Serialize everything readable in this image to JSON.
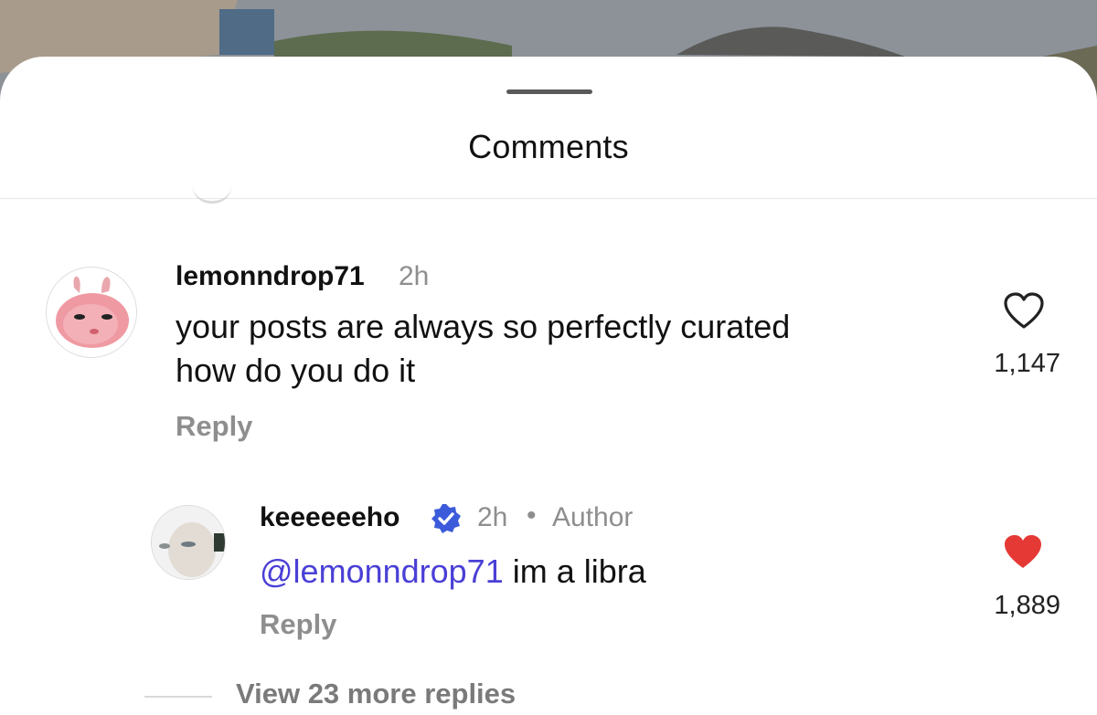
{
  "sheet": {
    "title": "Comments"
  },
  "comments": [
    {
      "username": "lemonndrop71",
      "time": "2h",
      "text_line1": "your posts are always so perfectly curated",
      "text_line2": "how do you do it",
      "reply_label": "Reply",
      "like_count": "1,147",
      "liked": false
    }
  ],
  "replies": [
    {
      "username": "keeeeeeho",
      "verified": true,
      "time": "2h",
      "separator": "•",
      "role_badge": "Author",
      "mention": "@lemonndrop71",
      "text": " im a libra",
      "reply_label": "Reply",
      "like_count": "1,889",
      "liked": true
    }
  ],
  "view_more": "View 23 more replies",
  "colors": {
    "mention": "#4a3fd6",
    "liked_heart": "#e53935",
    "verified_badge": "#3b5bdb",
    "muted_text": "#8e8e8e"
  }
}
